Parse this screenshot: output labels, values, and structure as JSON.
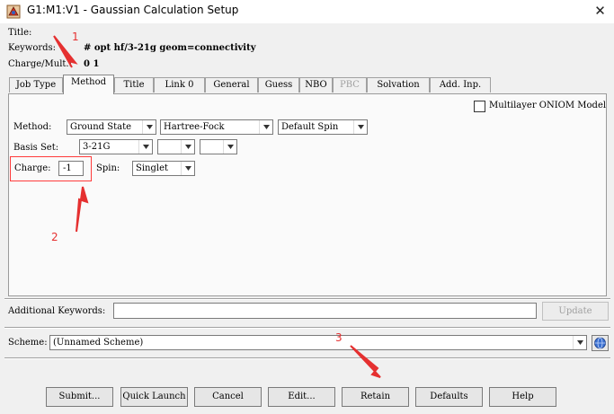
{
  "window": {
    "title": "G1:M1:V1 - Gaussian Calculation Setup",
    "close_glyph": "✕"
  },
  "header": {
    "title_label": "Title:",
    "title_value": "",
    "keywords_label": "Keywords:",
    "keywords_value": "# opt hf/3-21g geom=connectivity",
    "charge_mult_label": "Charge/Mult.:",
    "charge_mult_value": "0 1"
  },
  "tabs": [
    {
      "label": "Job Type",
      "active": false,
      "disabled": false
    },
    {
      "label": "Method",
      "active": true,
      "disabled": false
    },
    {
      "label": "Title",
      "active": false,
      "disabled": false
    },
    {
      "label": "Link 0",
      "active": false,
      "disabled": false
    },
    {
      "label": "General",
      "active": false,
      "disabled": false
    },
    {
      "label": "Guess",
      "active": false,
      "disabled": false
    },
    {
      "label": "NBO",
      "active": false,
      "disabled": false
    },
    {
      "label": "PBC",
      "active": false,
      "disabled": true
    },
    {
      "label": "Solvation",
      "active": false,
      "disabled": false
    },
    {
      "label": "Add. Inp.",
      "active": false,
      "disabled": false
    }
  ],
  "method_tab": {
    "multilayer_label": "Multilayer ONIOM Model",
    "multilayer_checked": false,
    "method_label": "Method:",
    "method_state": "Ground State",
    "method_theory": "Hartree-Fock",
    "method_spin": "Default Spin",
    "basis_label": "Basis Set:",
    "basis_value": "3-21G",
    "basis_opt1": "",
    "basis_opt2": "",
    "charge_label": "Charge:",
    "charge_value": "-1",
    "spin_label": "Spin:",
    "spin_value": "Singlet"
  },
  "additional": {
    "label": "Additional Keywords:",
    "value": "",
    "update_label": "Update"
  },
  "scheme": {
    "label": "Scheme:",
    "value": "(Unnamed Scheme)",
    "icon": "scheme-globe-icon"
  },
  "buttons": {
    "submit": "Submit...",
    "quick_launch": "Quick Launch",
    "cancel": "Cancel",
    "edit": "Edit...",
    "retain": "Retain",
    "defaults": "Defaults",
    "help": "Help"
  },
  "annotations": {
    "n1": "1",
    "n2": "2",
    "n3": "3",
    "color": "#e53030"
  }
}
